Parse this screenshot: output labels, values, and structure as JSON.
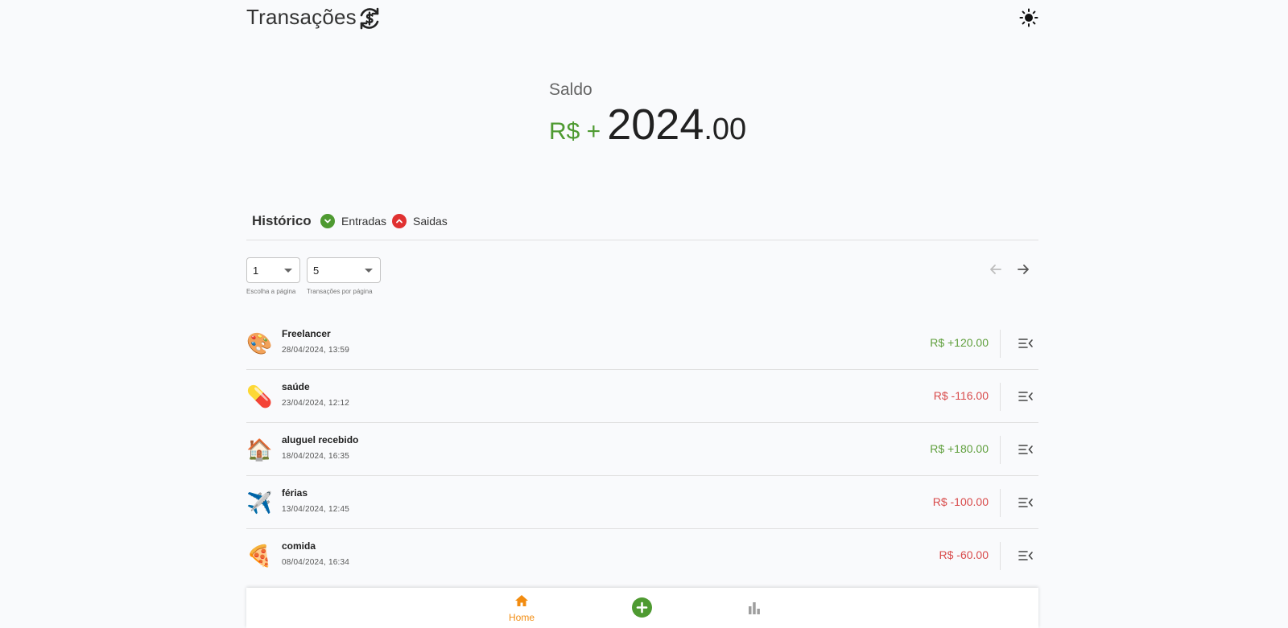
{
  "header": {
    "title": "Transações",
    "brand_icon": "currency-exchange-icon",
    "theme_icon": "sun-icon"
  },
  "balance": {
    "label": "Saldo",
    "currency_sign": "R$ +",
    "integer": "2024",
    "decimals": ".00"
  },
  "history": {
    "title": "Histórico",
    "legend_in": "Entradas",
    "legend_out": "Saidas"
  },
  "pagination": {
    "page_value": "1",
    "page_helper": "Escolha a página",
    "per_page_value": "5",
    "per_page_helper": "Transações por página"
  },
  "transactions": [
    {
      "emoji": "🎨",
      "name": "Freelancer",
      "date": "28/04/2024, 13:59",
      "amount": "R$ +120.00",
      "type": "in"
    },
    {
      "emoji": "💊",
      "name": "saúde",
      "date": "23/04/2024, 12:12",
      "amount": "R$ -116.00",
      "type": "out"
    },
    {
      "emoji": "🏠",
      "name": "aluguel recebido",
      "date": "18/04/2024, 16:35",
      "amount": "R$ +180.00",
      "type": "in"
    },
    {
      "emoji": "✈️",
      "name": "férias",
      "date": "13/04/2024, 12:45",
      "amount": "R$ -100.00",
      "type": "out"
    },
    {
      "emoji": "🍕",
      "name": "comida",
      "date": "08/04/2024, 16:34",
      "amount": "R$ -60.00",
      "type": "out"
    }
  ],
  "bottom_nav": {
    "home_label": "Home"
  },
  "colors": {
    "income": "#5f9f3c",
    "expense": "#d84a4a",
    "accent": "#f28c10",
    "brand_green": "#4e9a31"
  }
}
